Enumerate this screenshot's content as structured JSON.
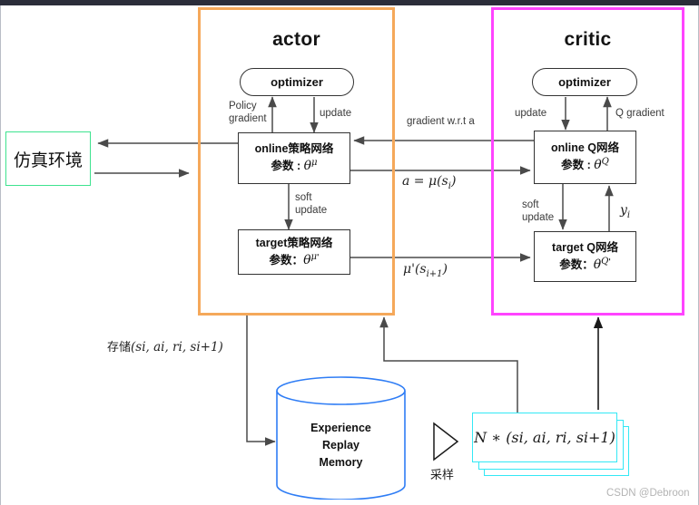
{
  "diagram": {
    "title_actor": "actor",
    "title_critic": "critic",
    "watermark": "CSDN @Debroon"
  },
  "environment": {
    "label": "仿真环境"
  },
  "actor": {
    "frame_color": "#F5A85A",
    "optimizer_label": "optimizer",
    "online_net": {
      "line1": "online策略网络",
      "line2_prefix": "参数 :",
      "param": "θ",
      "param_sup": "μ"
    },
    "target_net": {
      "line1": "target策略网络",
      "line2_prefix": "参数：",
      "param": "θ",
      "param_sup": "μ",
      "param_prime": "'"
    },
    "labels": {
      "policy_gradient": "Policy\ngradient",
      "update": "update",
      "soft_update": "soft\nupdate"
    }
  },
  "critic": {
    "frame_color": "#FF44FF",
    "optimizer_label": "optimizer",
    "online_net": {
      "line1": "online Q网络",
      "line2_prefix": "参数 :",
      "param": "θ",
      "param_sup": "Q"
    },
    "target_net": {
      "line1": "target Q网络",
      "line2_prefix": "参数：",
      "param": "θ",
      "param_sup": "Q",
      "param_prime": "'"
    },
    "labels": {
      "update": "update",
      "q_gradient": "Q gradient",
      "soft_update": "soft\nupdate",
      "y_i": "y",
      "y_i_sub": "i"
    }
  },
  "middle_labels": {
    "gradient_wrt_a": "gradient w.r.t a",
    "action": "a = μ(s",
    "action_sub": "i",
    "action_close": ")",
    "target_action": "μ'(s",
    "target_action_sub": "i+1",
    "target_action_close": ")"
  },
  "memory": {
    "store_label_cjk": "存储",
    "store_label_math": "(s",
    "store_tuple": "(si, ai, ri, si+1)",
    "cylinder_line1": "Experience",
    "cylinder_line2": "Replay",
    "cylinder_line3": "Memory",
    "cylinder_color": "#2f7df5",
    "sample_label": "采样",
    "batch_label": "N ∗ (si, ai, ri, si+1)",
    "batch_color": "#33E8F5"
  }
}
